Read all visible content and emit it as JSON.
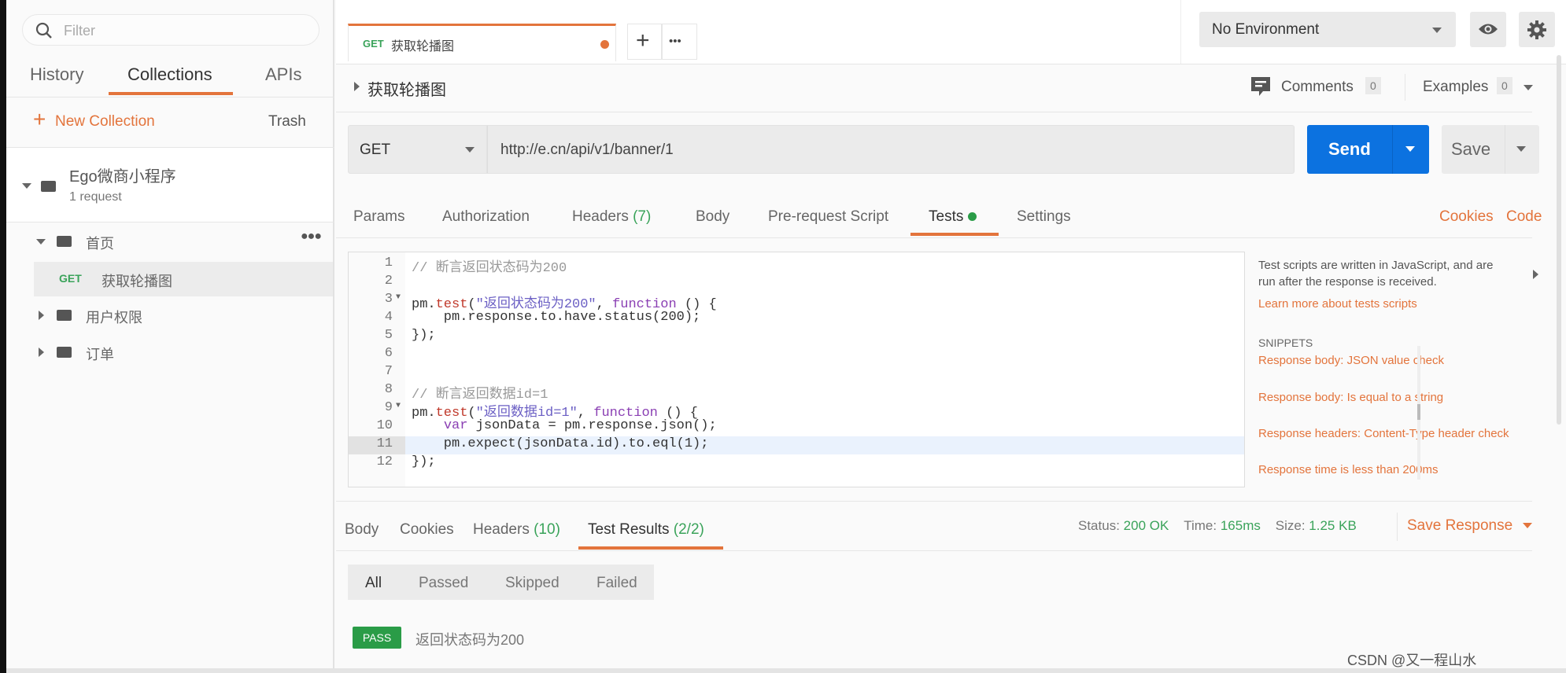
{
  "sidebar": {
    "filter_placeholder": "Filter",
    "tabs": [
      "History",
      "Collections",
      "APIs"
    ],
    "active_tab": "Collections",
    "new_collection": "New Collection",
    "trash": "Trash",
    "collection": {
      "name": "Ego微商小程序",
      "count": "1 request"
    },
    "folders": [
      {
        "name": "首页",
        "expanded": true,
        "requests": [
          {
            "method": "GET",
            "name": "获取轮播图"
          }
        ]
      },
      {
        "name": "用户权限",
        "expanded": false
      },
      {
        "name": "订单",
        "expanded": false
      }
    ]
  },
  "tabbar": {
    "tab": {
      "method": "GET",
      "name": "获取轮播图"
    },
    "add": "+",
    "more": "•••"
  },
  "env": {
    "selected": "No Environment"
  },
  "request": {
    "name": "获取轮播图",
    "comments_label": "Comments",
    "comments_count": "0",
    "examples_label": "Examples",
    "examples_count": "0",
    "method": "GET",
    "url": "http://e.cn/api/v1/banner/1",
    "send": "Send",
    "save": "Save",
    "tabs": [
      {
        "label": "Params"
      },
      {
        "label": "Authorization"
      },
      {
        "label": "Headers",
        "count": "(7)"
      },
      {
        "label": "Body"
      },
      {
        "label": "Pre-request Script"
      },
      {
        "label": "Tests"
      },
      {
        "label": "Settings"
      }
    ],
    "active_tab": "Tests",
    "cookies": "Cookies",
    "code": "Code"
  },
  "editor": {
    "lines": [
      "// 断言返回状态码为200",
      "",
      "pm.test(\"返回状态码为200\", function () {",
      "    pm.response.to.have.status(200);",
      "});",
      "",
      "",
      "// 断言返回数据id=1",
      "pm.test(\"返回数据id=1\", function () {",
      "    var jsonData = pm.response.json();",
      "    pm.expect(jsonData.id).to.eql(1);",
      "});"
    ],
    "active_line": 11
  },
  "help": {
    "line1": "Test scripts are written in JavaScript, and are",
    "line2": "run after the response is received.",
    "learn": "Learn more about tests scripts",
    "snippets_title": "SNIPPETS",
    "snippets": [
      "Response body: JSON value check",
      "Response body: Is equal to a string",
      "Response headers: Content-Type header check",
      "Response time is less than 200ms"
    ]
  },
  "response": {
    "tabs": [
      {
        "label": "Body"
      },
      {
        "label": "Cookies"
      },
      {
        "label": "Headers",
        "count": "(10)"
      },
      {
        "label": "Test Results",
        "count": "(2/2)"
      }
    ],
    "active_tab": "Test Results",
    "status_label": "Status:",
    "status": "200 OK",
    "time_label": "Time:",
    "time": "165ms",
    "size_label": "Size:",
    "size": "1.25 KB",
    "save_response": "Save Response",
    "filters": [
      "All",
      "Passed",
      "Skipped",
      "Failed"
    ],
    "active_filter": "All",
    "results": [
      {
        "badge": "PASS",
        "name": "返回状态码为200"
      }
    ]
  },
  "watermark": "CSDN @又一程山水",
  "colors": {
    "accent": "#e3743c",
    "send": "#0c72e0",
    "pass": "#2a9c47"
  }
}
